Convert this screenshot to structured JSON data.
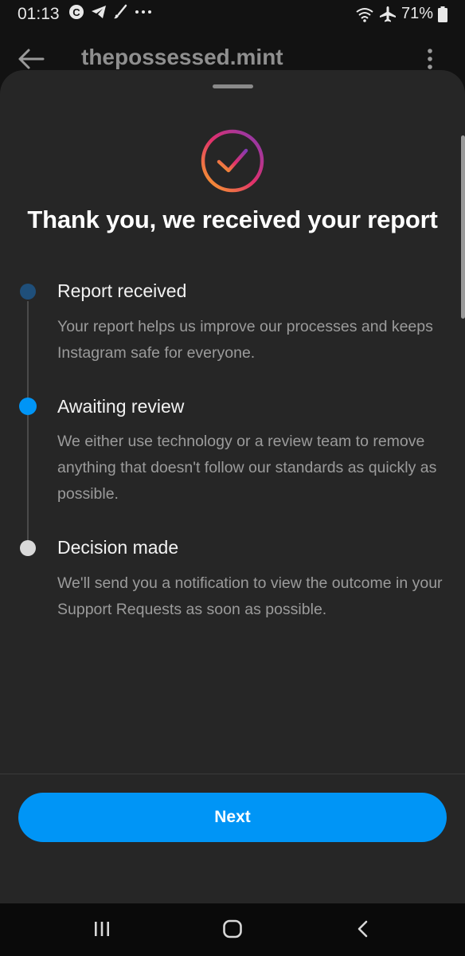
{
  "status_bar": {
    "time": "01:13",
    "battery": "71%",
    "left_icons": [
      "c-circle-icon",
      "telegram-icon",
      "brush-icon",
      "more-dots-icon"
    ],
    "right_icons": [
      "wifi-icon",
      "airplane-icon",
      "battery-icon"
    ]
  },
  "header": {
    "title": "thepossessed.mint"
  },
  "sheet": {
    "title": "Thank you, we received your report",
    "steps": [
      {
        "title": "Report received",
        "description": "Your report helps us improve our processes and keeps Instagram safe for everyone.",
        "dot_color": "#1f4f7a"
      },
      {
        "title": "Awaiting review",
        "description": "We either use technology or a review team to remove anything that doesn't follow our standards as quickly as possible.",
        "dot_color": "#0095f6"
      },
      {
        "title": "Decision made",
        "description": "We'll send you a notification to view the outcome in your Support Requests as soon as possible.",
        "dot_color": "#d9d9d9"
      }
    ],
    "next_label": "Next"
  },
  "colors": {
    "accent": "#0095f6",
    "sheet_bg": "#262626",
    "gradient": [
      "#f9a825",
      "#e1306c",
      "#833ab4"
    ]
  }
}
